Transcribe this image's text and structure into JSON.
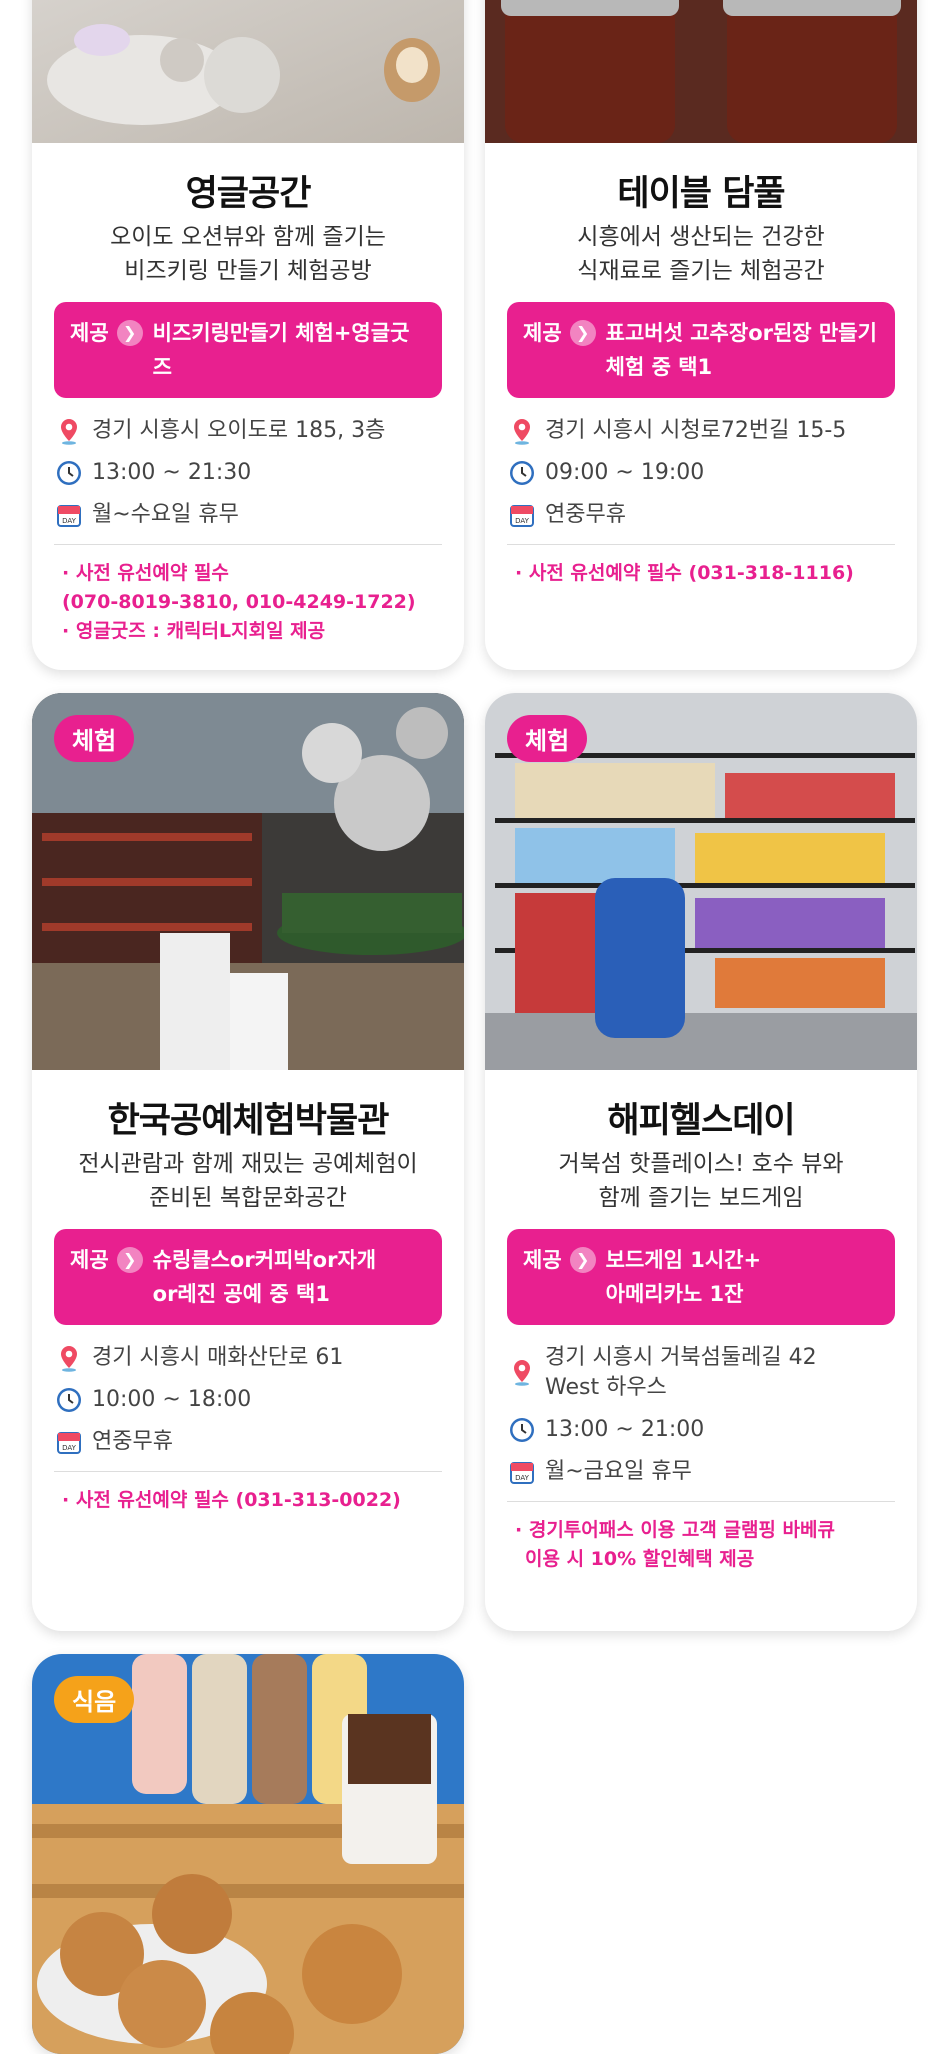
{
  "cards": [
    {
      "badge": "",
      "title": "영글공간",
      "desc": [
        "오이도 오션뷰와 함께 즐기는",
        "비즈키링 만들기 체험공방"
      ],
      "provide_tag": "제공",
      "provide": [
        "비즈키링만들기 체험+영글굿즈"
      ],
      "address": "경기 시흥시 오이도로 185, 3층",
      "hours": "13:00 ~ 21:30",
      "closed": "월~수요일 휴무",
      "notes": [
        "· 사전 유선예약 필수",
        "(070-8019-3810, 010-4249-1722)",
        "· 영글굿즈 : 캐릭터L지회일 제공"
      ]
    },
    {
      "badge": "",
      "title": "테이블 담풀",
      "desc": [
        "시흥에서 생산되는 건강한",
        "식재료로 즐기는 체험공간"
      ],
      "provide_tag": "제공",
      "provide": [
        "표고버섯 고추장or된장 만들기",
        "체험 중 택1"
      ],
      "address": "경기 시흥시 시청로72번길 15-5",
      "hours": "09:00 ~ 19:00",
      "closed": "연중무휴",
      "notes": [
        "· 사전 유선예약 필수 (031-318-1116)"
      ]
    },
    {
      "badge": "체험",
      "title": "한국공예체험박물관",
      "desc": [
        "전시관람과 함께 재밌는 공예체험이",
        "준비된 복합문화공간"
      ],
      "provide_tag": "제공",
      "provide": [
        "슈링클스or커피박or자개",
        "or레진 공예 중 택1"
      ],
      "address": "경기 시흥시 매화산단로 61",
      "hours": "10:00 ~ 18:00",
      "closed": "연중무휴",
      "notes": [
        "· 사전 유선예약 필수 (031-313-0022)"
      ]
    },
    {
      "badge": "체험",
      "title": "해피헬스데이",
      "desc": [
        "거북섬 핫플레이스! 호수 뷰와",
        "함께 즐기는 보드게임"
      ],
      "provide_tag": "제공",
      "provide": [
        "보드게임 1시간+",
        "아메리카노 1잔"
      ],
      "address": "경기 시흥시 거북섬둘레길 42 West 하우스",
      "hours": "13:00 ~ 21:00",
      "closed": "월~금요일 휴무",
      "notes": [
        "· 경기투어패스 이용 고객 글램핑 바베큐",
        "이용 시 10% 할인혜택 제공"
      ]
    },
    {
      "badge": "식음",
      "title": "",
      "desc": [],
      "provide_tag": "",
      "provide": [],
      "address": "",
      "hours": "",
      "closed": "",
      "notes": []
    }
  ],
  "colors": {
    "accent": "#e8208f",
    "badge_experience": "#e8208f",
    "badge_food": "#f5a21a"
  },
  "icons": {
    "address": "map-pin-icon",
    "hours": "clock-icon",
    "closed": "calendar-icon",
    "arrow": "chevron-right-icon"
  }
}
